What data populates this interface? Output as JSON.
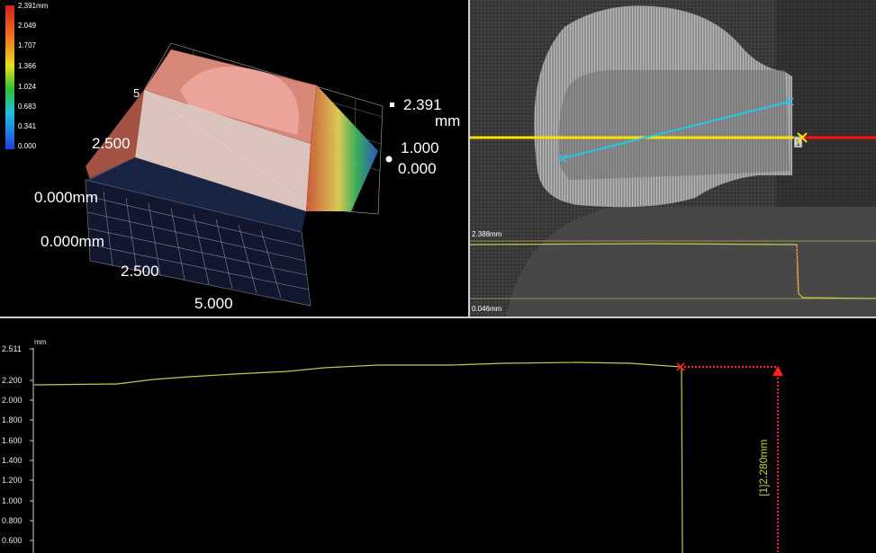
{
  "color_scale": {
    "title": "2.391mm",
    "values": [
      "2.049",
      "1.707",
      "1.366",
      "1.024",
      "0.683",
      "0.341",
      "0.000"
    ]
  },
  "view3d": {
    "x_labels": [
      "0.000mm",
      "2.500",
      "5.000"
    ],
    "y_labels": [
      "0.000mm",
      "2.500",
      "5"
    ],
    "z_max": "2.391",
    "z_unit": "mm",
    "z_mid": "1.000",
    "z_min": "0.000"
  },
  "image_view": {
    "profile_top": "2.388mm",
    "profile_bottom": "0.046mm",
    "marker_label": "1"
  },
  "profile": {
    "unit": "mm",
    "y_ticks": [
      "2.511",
      "2.200",
      "2.000",
      "1.800",
      "1.600",
      "1.400",
      "1.200",
      "1.000",
      "0.800",
      "0.600"
    ],
    "measurement": "[1]2.280mm"
  },
  "colors": {
    "profile_line": "#c8c84a",
    "measure": "#ff2020",
    "yellow": "#ffe000",
    "cyan": "#20c8e8"
  }
}
